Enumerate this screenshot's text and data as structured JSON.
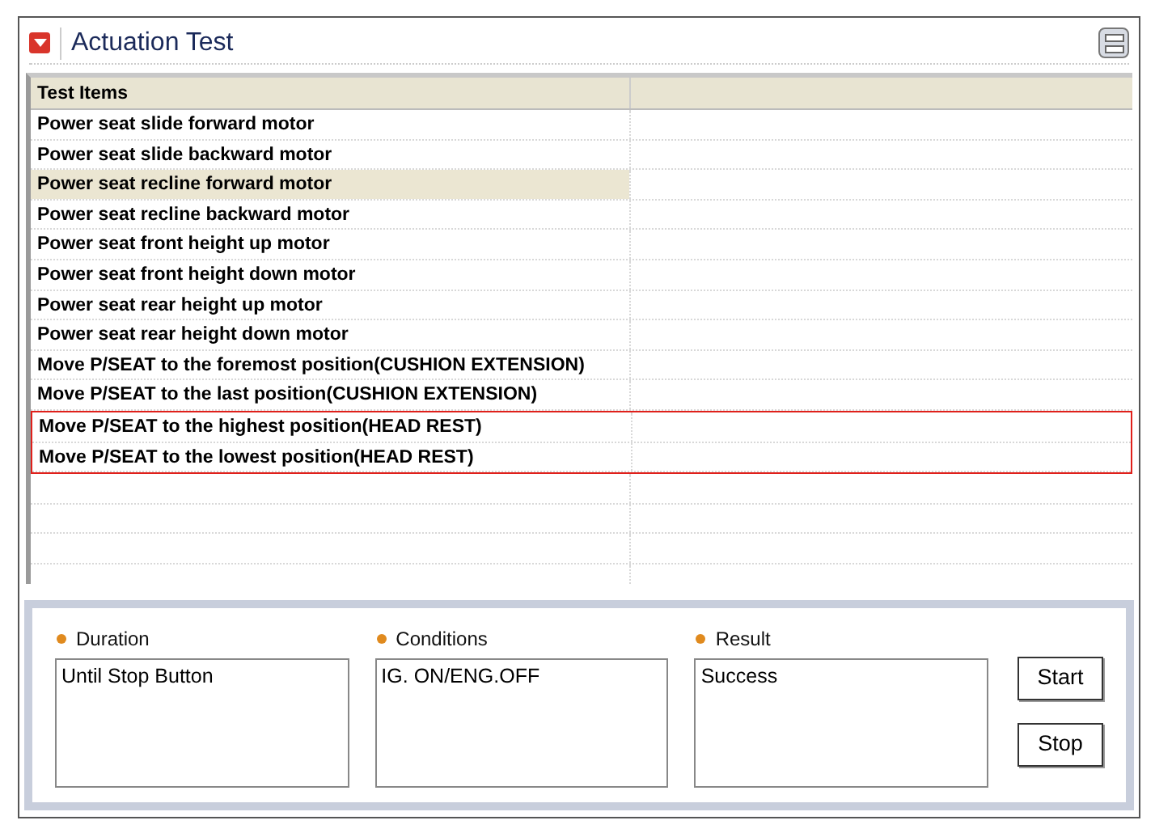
{
  "window": {
    "title": "Actuation Test"
  },
  "table": {
    "columns": [
      "Test Items"
    ],
    "rows": [
      {
        "label": "Power seat slide forward motor",
        "selected": false,
        "framed": false
      },
      {
        "label": "Power seat slide backward motor",
        "selected": false,
        "framed": false
      },
      {
        "label": "Power seat recline forward motor",
        "selected": true,
        "framed": false
      },
      {
        "label": "Power seat recline backward motor",
        "selected": false,
        "framed": false
      },
      {
        "label": "Power seat front height up motor",
        "selected": false,
        "framed": false
      },
      {
        "label": "Power seat front height down motor",
        "selected": false,
        "framed": false
      },
      {
        "label": "Power seat rear height up motor",
        "selected": false,
        "framed": false
      },
      {
        "label": "Power seat rear height down motor",
        "selected": false,
        "framed": false
      },
      {
        "label": "Move P/SEAT to the foremost position(CUSHION EXTENSION)",
        "selected": false,
        "framed": false
      },
      {
        "label": "Move P/SEAT to the last position(CUSHION EXTENSION)",
        "selected": false,
        "framed": false
      },
      {
        "label": "Move P/SEAT to the highest position(HEAD REST)",
        "selected": false,
        "framed": true
      },
      {
        "label": "Move P/SEAT to the lowest position(HEAD REST)",
        "selected": false,
        "framed": true
      }
    ]
  },
  "details": [
    {
      "label": "Duration",
      "value": "Until Stop Button"
    },
    {
      "label": "Conditions",
      "value": "IG. ON/ENG.OFF"
    },
    {
      "label": "Result",
      "value": "Success"
    }
  ],
  "buttons": [
    "Start",
    "Stop"
  ]
}
